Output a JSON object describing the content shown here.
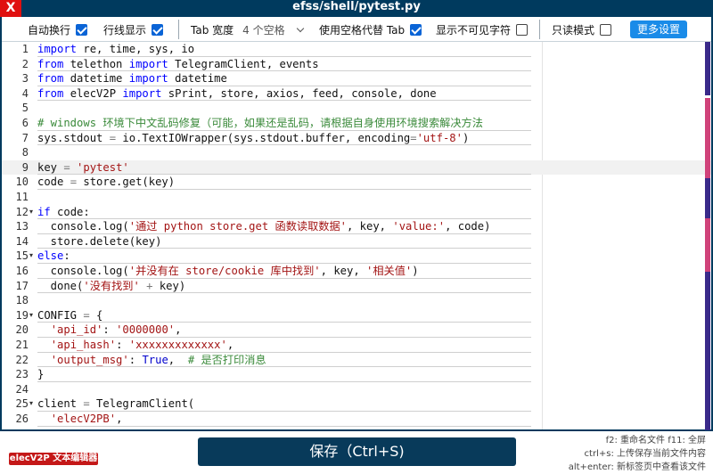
{
  "window": {
    "title": "efss/shell/pytest.py",
    "close_label": "X"
  },
  "toolbar": {
    "auto_wrap": {
      "label": "自动换行",
      "checked": true
    },
    "line_numbers": {
      "label": "行线显示",
      "checked": true
    },
    "tab_width": {
      "label": "Tab 宽度",
      "value": "4 个空格"
    },
    "use_spaces": {
      "label": "使用空格代替 Tab",
      "checked": true
    },
    "show_invisibles": {
      "label": "显示不可见字符",
      "checked": false
    },
    "read_only": {
      "label": "只读模式",
      "checked": false
    },
    "more_settings_label": "更多设置"
  },
  "editor": {
    "active_line": 9,
    "lines": [
      {
        "n": "1",
        "fold": "",
        "tokens": [
          [
            "kw",
            "import"
          ],
          [
            "t",
            " re, time, sys, io"
          ]
        ]
      },
      {
        "n": "2",
        "fold": "",
        "tokens": [
          [
            "kw",
            "from"
          ],
          [
            "t",
            " telethon "
          ],
          [
            "kw",
            "import"
          ],
          [
            "t",
            " TelegramClient, events"
          ]
        ]
      },
      {
        "n": "3",
        "fold": "",
        "tokens": [
          [
            "kw",
            "from"
          ],
          [
            "t",
            " datetime "
          ],
          [
            "kw",
            "import"
          ],
          [
            "t",
            " datetime"
          ]
        ]
      },
      {
        "n": "4",
        "fold": "",
        "tokens": [
          [
            "kw",
            "from"
          ],
          [
            "t",
            " elecV2P "
          ],
          [
            "kw",
            "import"
          ],
          [
            "t",
            " sPrint, store, axios, feed, console, done"
          ]
        ]
      },
      {
        "n": "5",
        "fold": "",
        "tokens": []
      },
      {
        "n": "6",
        "fold": "",
        "tokens": [
          [
            "com",
            "# windows 环境下中文乱码修复（可能，如果还是乱码，请根据自身使用环境搜索解决方法"
          ]
        ]
      },
      {
        "n": "7",
        "fold": "",
        "tokens": [
          [
            "t",
            "sys.stdout "
          ],
          [
            "op",
            "="
          ],
          [
            "t",
            " io.TextIOWrapper(sys.stdout.buffer, encoding"
          ],
          [
            "op",
            "="
          ],
          [
            "str",
            "'utf-8'"
          ],
          [
            "t",
            ")"
          ]
        ]
      },
      {
        "n": "8",
        "fold": "",
        "tokens": []
      },
      {
        "n": "9",
        "fold": "",
        "tokens": [
          [
            "t",
            "key "
          ],
          [
            "op",
            "="
          ],
          [
            "t",
            " "
          ],
          [
            "str",
            "'pytest'"
          ]
        ]
      },
      {
        "n": "10",
        "fold": "",
        "tokens": [
          [
            "t",
            "code "
          ],
          [
            "op",
            "="
          ],
          [
            "t",
            " store.get(key)"
          ]
        ]
      },
      {
        "n": "11",
        "fold": "",
        "tokens": []
      },
      {
        "n": "12",
        "fold": "▾",
        "tokens": [
          [
            "kw",
            "if"
          ],
          [
            "t",
            " code:"
          ]
        ]
      },
      {
        "n": "13",
        "fold": "",
        "tokens": [
          [
            "t",
            "  console.log("
          ],
          [
            "str",
            "'通过 python store.get 函数读取数据'"
          ],
          [
            "t",
            ", key, "
          ],
          [
            "str",
            "'value:'"
          ],
          [
            "t",
            ", code)"
          ]
        ]
      },
      {
        "n": "14",
        "fold": "",
        "tokens": [
          [
            "t",
            "  store.delete(key)"
          ]
        ]
      },
      {
        "n": "15",
        "fold": "▾",
        "tokens": [
          [
            "kw",
            "else"
          ],
          [
            "t",
            ":"
          ]
        ]
      },
      {
        "n": "16",
        "fold": "",
        "tokens": [
          [
            "t",
            "  console.log("
          ],
          [
            "str",
            "'并没有在 store/cookie 库中找到'"
          ],
          [
            "t",
            ", key, "
          ],
          [
            "str",
            "'相关值'"
          ],
          [
            "t",
            ")"
          ]
        ]
      },
      {
        "n": "17",
        "fold": "",
        "tokens": [
          [
            "t",
            "  done("
          ],
          [
            "str",
            "'没有找到'"
          ],
          [
            "t",
            " "
          ],
          [
            "op",
            "+"
          ],
          [
            "t",
            " key)"
          ]
        ]
      },
      {
        "n": "18",
        "fold": "",
        "tokens": []
      },
      {
        "n": "19",
        "fold": "▾",
        "tokens": [
          [
            "t",
            "CONFIG "
          ],
          [
            "op",
            "="
          ],
          [
            "t",
            " {"
          ]
        ]
      },
      {
        "n": "20",
        "fold": "",
        "tokens": [
          [
            "t",
            "  "
          ],
          [
            "str",
            "'api_id'"
          ],
          [
            "t",
            ": "
          ],
          [
            "str",
            "'0000000'"
          ],
          [
            "t",
            ","
          ]
        ]
      },
      {
        "n": "21",
        "fold": "",
        "tokens": [
          [
            "t",
            "  "
          ],
          [
            "str",
            "'api_hash'"
          ],
          [
            "t",
            ": "
          ],
          [
            "str",
            "'xxxxxxxxxxxxx'"
          ],
          [
            "t",
            ","
          ]
        ]
      },
      {
        "n": "22",
        "fold": "",
        "tokens": [
          [
            "t",
            "  "
          ],
          [
            "str",
            "'output_msg'"
          ],
          [
            "t",
            ": "
          ],
          [
            "bool",
            "True"
          ],
          [
            "t",
            ",  "
          ],
          [
            "com",
            "# 是否打印消息"
          ]
        ]
      },
      {
        "n": "23",
        "fold": "",
        "tokens": [
          [
            "t",
            "}"
          ]
        ]
      },
      {
        "n": "24",
        "fold": "",
        "tokens": []
      },
      {
        "n": "25",
        "fold": "▾",
        "tokens": [
          [
            "t",
            "client "
          ],
          [
            "op",
            "="
          ],
          [
            "t",
            " TelegramClient("
          ]
        ]
      },
      {
        "n": "26",
        "fold": "",
        "tokens": [
          [
            "t",
            "  "
          ],
          [
            "str",
            "'elecV2PB'"
          ],
          [
            "t",
            ","
          ]
        ]
      }
    ]
  },
  "footer": {
    "logo_text": "elecV2P 文本编辑器",
    "save_label": "保存（Ctrl+S)",
    "hints": [
      "f2: 重命名文件 f11: 全屏",
      "ctrl+s: 上传保存当前文件内容",
      "alt+enter: 新标签页中查看该文件"
    ]
  },
  "colors": {
    "title_bar": "#003a5e",
    "close_button": "#e01010",
    "checkbox_checked": "#0a64d6",
    "more_button": "#1a8be8",
    "save_button": "#083a5a",
    "keyword": "#0000ff",
    "string": "#a31515",
    "comment": "#3a8a3a",
    "logo": "#c41818"
  }
}
